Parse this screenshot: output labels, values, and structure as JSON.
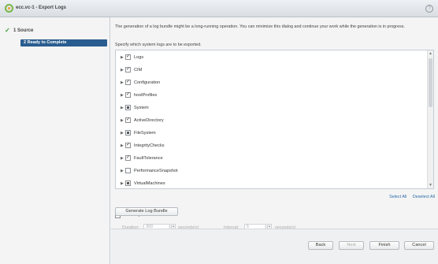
{
  "window": {
    "title": "ecc.vc-1 - Export Logs",
    "help_icon": "?"
  },
  "steps": [
    {
      "number": "1",
      "label": "Source",
      "status": "complete"
    },
    {
      "number": "2",
      "label": "Ready to Complete",
      "status": "active"
    }
  ],
  "main": {
    "description": "The generation of a log bundle might be a long-running operation. You can minimize this dialog and continue your work while the generation is in progress.",
    "specify": "Specify which system logs are to be exported.",
    "tree": [
      {
        "label": "Logs",
        "state": "checked"
      },
      {
        "label": "CIM",
        "state": "checked"
      },
      {
        "label": "Configuration",
        "state": "checked"
      },
      {
        "label": "hostProfiles",
        "state": "checked"
      },
      {
        "label": "System",
        "state": "partial"
      },
      {
        "label": "ActiveDirectory",
        "state": "checked"
      },
      {
        "label": "FileSystem",
        "state": "partial"
      },
      {
        "label": "IntegrityChecks",
        "state": "checked"
      },
      {
        "label": "FaultTolerance",
        "state": "checked"
      },
      {
        "label": "PerformanceSnapshot",
        "state": "unchecked"
      },
      {
        "label": "VirtualMachines",
        "state": "partial"
      }
    ],
    "select_all": "Select All",
    "deselect_all": "Deselect All",
    "gather_label": "Gather performance data",
    "duration_label": "Duration:",
    "duration_value": "300",
    "duration_unit": "seconds(s)",
    "interval_label": "Interval:",
    "interval_value": "5",
    "interval_unit": "seconds(s)",
    "generate_button": "Generate Log Bundle"
  },
  "footer": {
    "back": "Back",
    "next": "Next",
    "finish": "Finish",
    "cancel": "Cancel"
  },
  "colors": {
    "active_step": "#2a5d8f",
    "complete_check": "#3aa03a",
    "link": "#2a6aa8"
  }
}
